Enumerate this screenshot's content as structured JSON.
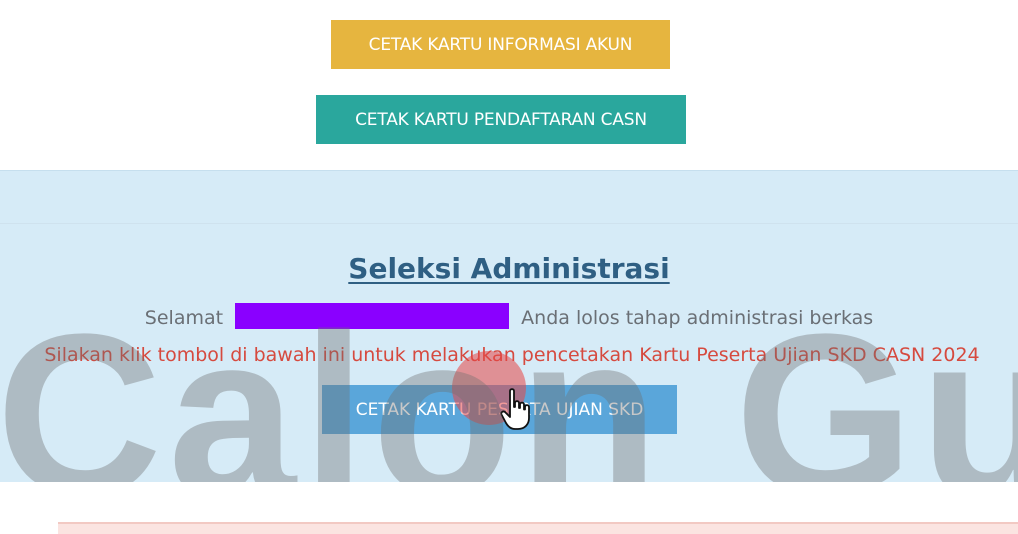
{
  "buttons": {
    "print_account_info": "CETAK KARTU INFORMASI AKUN",
    "print_registration": "CETAK KARTU PENDAFTARAN CASN",
    "print_skd": "CETAK KARTU PESERTA UJIAN SKD"
  },
  "admin_selection": {
    "title": "Seleksi Administrasi",
    "congrats_prefix": "Selamat",
    "congrats_suffix": "Anda lolos tahap administrasi berkas",
    "instruction": "Silakan klik tombol di bawah ini untuk melakukan pencetakan Kartu Peserta Ujian SKD CASN 2024"
  },
  "watermark": {
    "text": "Calon Guru"
  },
  "colors": {
    "account_button": "#e6b53f",
    "registration_button": "#2aa79d",
    "skd_button": "#5aa6da",
    "panel_background": "#d6ebf7",
    "instruction_text": "#d64a3f",
    "redaction": "#8a00ff"
  },
  "icons": {
    "cursor": "hand-pointer-icon"
  }
}
